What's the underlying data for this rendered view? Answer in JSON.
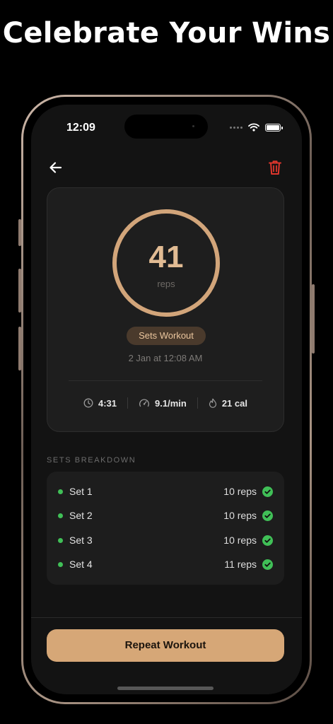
{
  "headline": "Celebrate Your Wins",
  "status_bar": {
    "time": "12:09"
  },
  "workout": {
    "reps": "41",
    "reps_unit": "reps",
    "type": "Sets Workout",
    "date": "2 Jan at 12:08 AM",
    "stats": [
      {
        "icon": "clock-icon",
        "value": "4:31"
      },
      {
        "icon": "speedometer-icon",
        "value": "9.1/min"
      },
      {
        "icon": "flame-icon",
        "value": "21 cal"
      }
    ]
  },
  "sets_breakdown": {
    "title": "SETS BREAKDOWN",
    "sets": [
      {
        "name": "Set 1",
        "reps": "10 reps"
      },
      {
        "name": "Set 2",
        "reps": "10 reps"
      },
      {
        "name": "Set 3",
        "reps": "10 reps"
      },
      {
        "name": "Set 4",
        "reps": "11 reps"
      }
    ]
  },
  "actions": {
    "repeat_label": "Repeat Workout"
  },
  "colors": {
    "accent": "#d6a777",
    "delete": "#e0362c",
    "complete": "#40c057",
    "background": "#131313"
  }
}
